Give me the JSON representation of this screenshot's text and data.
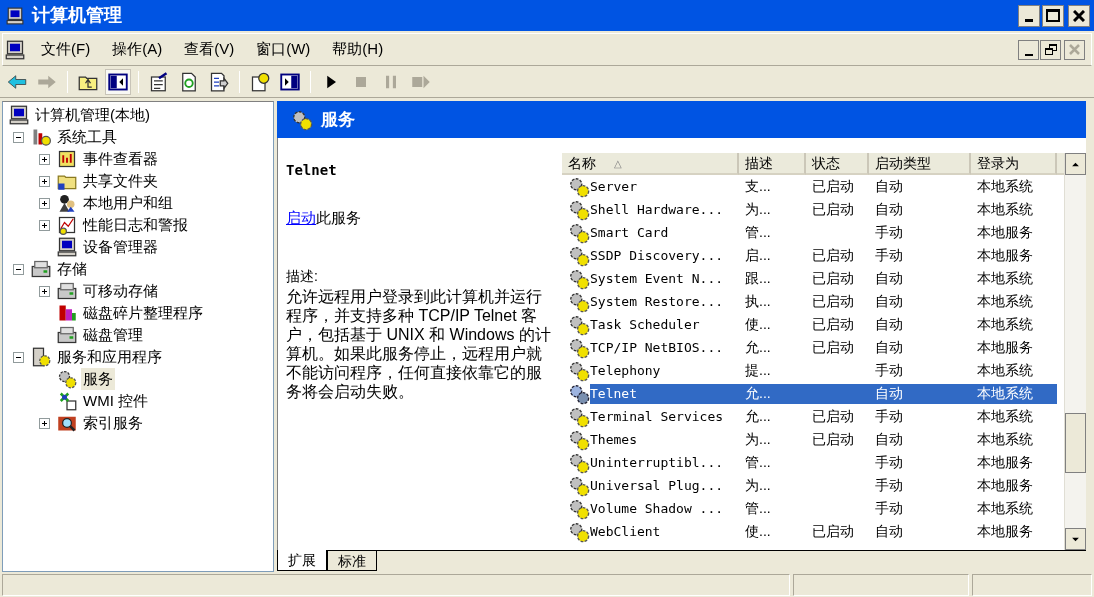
{
  "window": {
    "title": "计算机管理"
  },
  "menu": [
    "文件(F)",
    "操作(A)",
    "查看(V)",
    "窗口(W)",
    "帮助(H)"
  ],
  "toolbar": [
    {
      "kind": "back",
      "disabled": false,
      "pressed": false
    },
    {
      "kind": "forward",
      "disabled": true,
      "pressed": false
    },
    {
      "kind": "separator"
    },
    {
      "kind": "up",
      "disabled": false,
      "pressed": false
    },
    {
      "kind": "tree",
      "disabled": false,
      "pressed": true
    },
    {
      "kind": "separator"
    },
    {
      "kind": "properties",
      "disabled": false,
      "pressed": false
    },
    {
      "kind": "refresh",
      "disabled": false,
      "pressed": false
    },
    {
      "kind": "export",
      "disabled": false,
      "pressed": false
    },
    {
      "kind": "separator"
    },
    {
      "kind": "help",
      "disabled": false,
      "pressed": false
    },
    {
      "kind": "pane",
      "disabled": false,
      "pressed": false
    },
    {
      "kind": "separator"
    },
    {
      "kind": "play",
      "disabled": false,
      "pressed": false
    },
    {
      "kind": "stop",
      "disabled": true,
      "pressed": false
    },
    {
      "kind": "pause",
      "disabled": true,
      "pressed": false
    },
    {
      "kind": "restart",
      "disabled": true,
      "pressed": false
    }
  ],
  "tree": [
    {
      "label": "计算机管理(本地)",
      "kind": "leaf",
      "selected": false,
      "children": [
        {
          "label": "系统工具",
          "kind": "expanded",
          "selected": false,
          "children": [
            {
              "label": "事件查看器",
              "kind": "collapsed",
              "selected": false
            },
            {
              "label": "共享文件夹",
              "kind": "collapsed",
              "selected": false
            },
            {
              "label": "本地用户和组",
              "kind": "collapsed",
              "selected": false
            },
            {
              "label": "性能日志和警报",
              "kind": "collapsed",
              "selected": false
            },
            {
              "label": "设备管理器",
              "kind": "leaf",
              "selected": false
            }
          ]
        },
        {
          "label": "存储",
          "kind": "expanded",
          "selected": false,
          "children": [
            {
              "label": "可移动存储",
              "kind": "collapsed",
              "selected": false
            },
            {
              "label": "磁盘碎片整理程序",
              "kind": "leaf",
              "selected": false
            },
            {
              "label": "磁盘管理",
              "kind": "leaf",
              "selected": false
            }
          ]
        },
        {
          "label": "服务和应用程序",
          "kind": "expanded",
          "selected": false,
          "children": [
            {
              "label": "服务",
              "kind": "leaf",
              "selected": true
            },
            {
              "label": "WMI 控件",
              "kind": "leaf",
              "selected": false
            },
            {
              "label": "索引服务",
              "kind": "collapsed",
              "selected": false
            }
          ]
        }
      ]
    }
  ],
  "header": {
    "title": "服务"
  },
  "details": {
    "title": "Telnet",
    "action_link": "启动",
    "action_text": "此服务",
    "description_label": "描述:",
    "description": "允许远程用户登录到此计算机并运行程序，并支持多种 TCP/IP Telnet 客户，包括基于 UNIX 和 Windows 的计算机。如果此服务停止，远程用户就不能访问程序，任何直接依靠它的服务将会启动失败。"
  },
  "table": {
    "columns": [
      {
        "label": "名称",
        "sort": "△"
      },
      {
        "label": "描述"
      },
      {
        "label": "状态"
      },
      {
        "label": "启动类型"
      },
      {
        "label": "登录为"
      }
    ],
    "rows": [
      {
        "cells": [
          "Server",
          "支...",
          "已启动",
          "自动",
          "本地系统"
        ],
        "selected": false
      },
      {
        "cells": [
          "Shell Hardware...",
          "为...",
          "已启动",
          "自动",
          "本地系统"
        ],
        "selected": false
      },
      {
        "cells": [
          "Smart Card",
          "管...",
          "",
          "手动",
          "本地服务"
        ],
        "selected": false
      },
      {
        "cells": [
          "SSDP Discovery...",
          "启...",
          "已启动",
          "手动",
          "本地服务"
        ],
        "selected": false
      },
      {
        "cells": [
          "System Event N...",
          "跟...",
          "已启动",
          "自动",
          "本地系统"
        ],
        "selected": false
      },
      {
        "cells": [
          "System Restore...",
          "执...",
          "已启动",
          "自动",
          "本地系统"
        ],
        "selected": false
      },
      {
        "cells": [
          "Task Scheduler",
          "使...",
          "已启动",
          "自动",
          "本地系统"
        ],
        "selected": false
      },
      {
        "cells": [
          "TCP/IP NetBIOS...",
          "允...",
          "已启动",
          "自动",
          "本地服务"
        ],
        "selected": false
      },
      {
        "cells": [
          "Telephony",
          "提...",
          "",
          "手动",
          "本地系统"
        ],
        "selected": false
      },
      {
        "cells": [
          "Telnet",
          "允...",
          "",
          "自动",
          "本地系统"
        ],
        "selected": true
      },
      {
        "cells": [
          "Terminal Services",
          "允...",
          "已启动",
          "手动",
          "本地系统"
        ],
        "selected": false
      },
      {
        "cells": [
          "Themes",
          "为...",
          "已启动",
          "自动",
          "本地系统"
        ],
        "selected": false
      },
      {
        "cells": [
          "Uninterruptibl...",
          "管...",
          "",
          "手动",
          "本地服务"
        ],
        "selected": false
      },
      {
        "cells": [
          "Universal Plug...",
          "为...",
          "",
          "手动",
          "本地服务"
        ],
        "selected": false
      },
      {
        "cells": [
          "Volume Shadow ...",
          "管...",
          "",
          "手动",
          "本地系统"
        ],
        "selected": false
      },
      {
        "cells": [
          "WebClient",
          "使...",
          "已启动",
          "自动",
          "本地服务"
        ],
        "selected": false
      }
    ]
  },
  "tabs": [
    {
      "label": "扩展",
      "selected": true
    },
    {
      "label": "标准",
      "selected": false
    }
  ]
}
